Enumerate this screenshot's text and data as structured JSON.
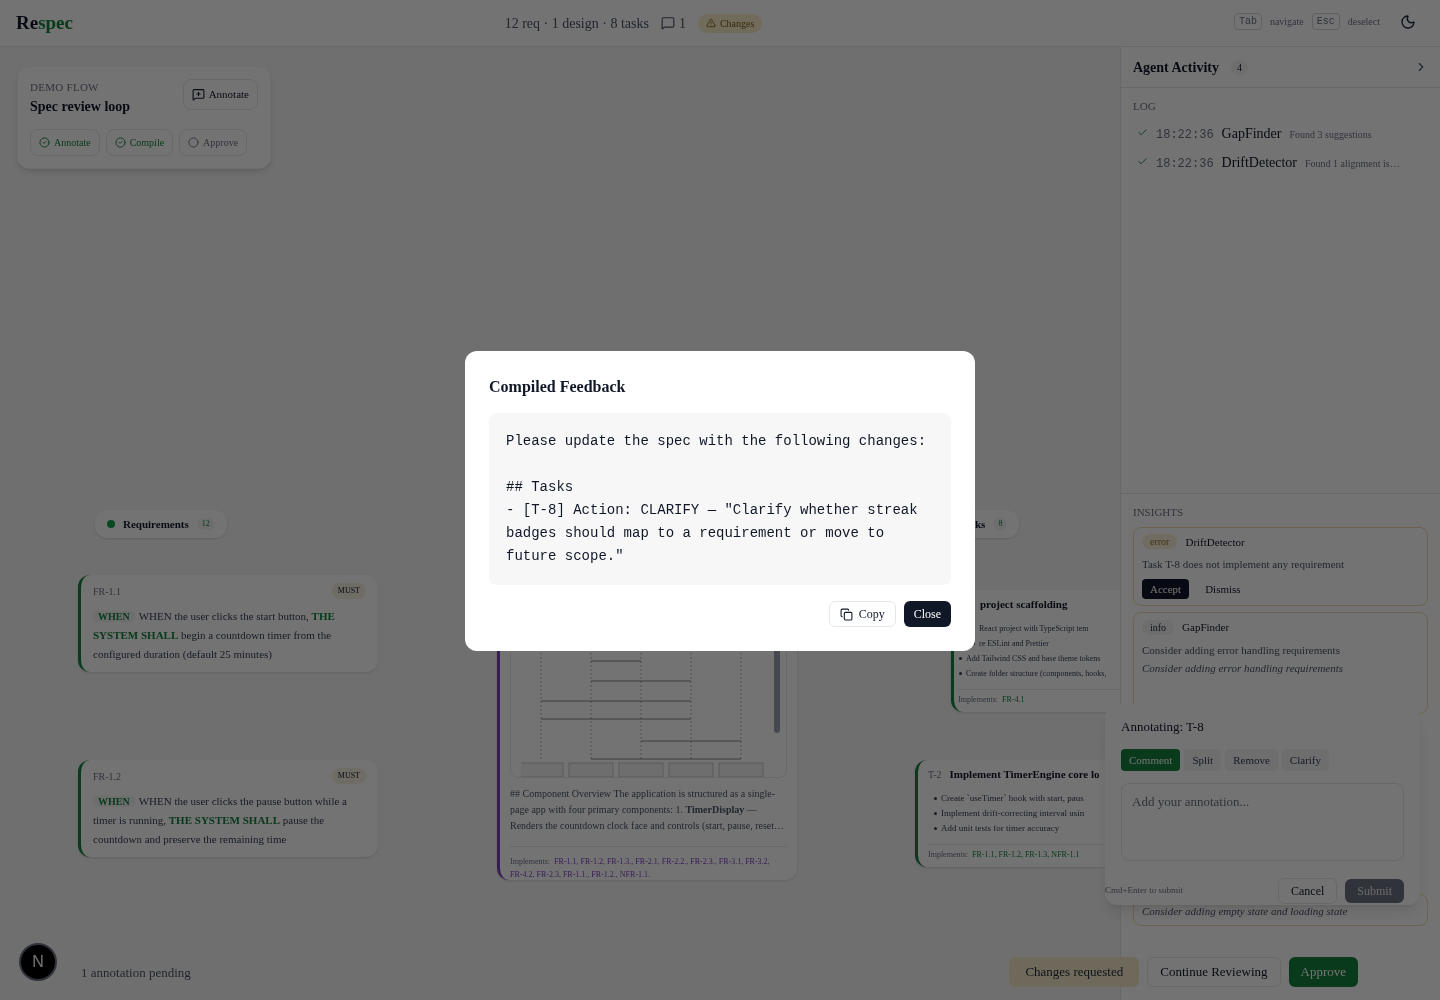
{
  "header": {
    "logo_dark": "Re",
    "logo_accent": "spec",
    "stats": "12 req · 1 design · 8 tasks",
    "comment_count": "1",
    "status_badge": "Changes",
    "shortcuts": [
      {
        "key": "Tab",
        "label": "navigate"
      },
      {
        "key": "Esc",
        "label": "deselect"
      }
    ]
  },
  "flow_card": {
    "eyebrow": "DEMO FLOW",
    "title": "Spec review loop",
    "action": "Annotate",
    "steps": [
      {
        "label": "Annotate",
        "done": true
      },
      {
        "label": "Compile",
        "done": true
      },
      {
        "label": "Approve",
        "done": false
      }
    ]
  },
  "canvas": {
    "requirements_pill": {
      "label": "Requirements",
      "count": "12"
    },
    "requirements": [
      {
        "id": "FR-1.1",
        "priority": "MUST",
        "keyword": "WHEN",
        "text": "WHEN the user clicks the start button, **THE SYSTEM SHALL** begin a countdown timer from the configured duration (default 25 minutes)"
      },
      {
        "id": "FR-1.2",
        "priority": "MUST",
        "keyword": "WHEN",
        "text": "WHEN the user clicks the pause button while a timer is running, **THE SYSTEM SHALL** pause the countdown and preserve the remaining time"
      }
    ],
    "design": {
      "text": "## Component Overview The application is structured as a single-page app with four primary components: 1. **TimerDisplay** — Renders the countdown clock face and controls (start, pause, reset…",
      "implements_label": "Implements:",
      "links": [
        "FR-1.1,",
        "FR-1.2,",
        "FR-1.3.,",
        "FR-2.1,",
        "FR-2.2.,",
        "FR-2.3.,",
        "FR-3.1,",
        "FR-3.2,",
        "FR-4.2,",
        "FR-2.3,",
        "FR-1.1.,",
        "FR-1.2.,",
        "NFR-1.1."
      ]
    },
    "tasks_pill": {
      "label": "ks",
      "count": "8"
    },
    "tasks": [
      {
        "title": "project scaffolding",
        "bullets": [
          "React project with TypeScript tem",
          "re ESLint and Prettier",
          "Add Tailwind CSS and base theme tokens",
          "Create folder structure (components, hooks,"
        ],
        "implements_label": "Implements:",
        "links": [
          "FR-4.1"
        ]
      },
      {
        "id": "T-2",
        "title": "Implement TimerEngine core lo",
        "bullets": [
          "Create `useTimer` hook with start, paus",
          "Implement drift-correcting interval usin",
          "Add unit tests for timer accuracy"
        ],
        "implements_label": "Implements:",
        "links": [
          "FR-1.1,",
          "FR-1.2,",
          "FR-1.3,",
          "NFR-1.1"
        ]
      }
    ]
  },
  "activity": {
    "title": "Agent Activity",
    "count": "4",
    "log_label": "LOG",
    "log": [
      {
        "time": "18:22:36",
        "agent": "GapFinder",
        "message": "Found 3 suggestions",
        "done": true
      },
      {
        "time": "18:22:36",
        "agent": "DriftDetector",
        "message": "Found 1 alignment is…",
        "done": true
      }
    ],
    "insights_label": "INSIGHTS",
    "insights": [
      {
        "severity": "error",
        "agent": "DriftDetector",
        "text": "Task T-8 does not implement any requirement",
        "actions": [
          "Accept",
          "Dismiss"
        ]
      },
      {
        "severity": "info",
        "agent": "GapFinder",
        "text": "Consider adding error handling requirements",
        "note": "Consider adding error handling requirements"
      },
      {
        "note": "Consider adding empty state and loading state"
      }
    ]
  },
  "annotation": {
    "title": "Annotating: T-8",
    "modes": [
      {
        "label": "Comment",
        "selected": true
      },
      {
        "label": "Split",
        "selected": false
      },
      {
        "label": "Remove",
        "selected": false
      },
      {
        "label": "Clarify",
        "selected": false
      }
    ],
    "placeholder": "Add your annotation...",
    "hint": "Cmd+Enter to submit",
    "cancel": "Cancel",
    "submit": "Submit",
    "submit_disabled": true
  },
  "footer": {
    "avatar": "N",
    "pending": "1 annotation pending",
    "status": "Changes requested",
    "continue": "Continue Reviewing",
    "approve": "Approve"
  },
  "dialog": {
    "title": "Compiled Feedback",
    "body": "Please update the spec with the following changes:\n\n## Tasks\n- [T-8] Action: CLARIFY — \"Clarify whether streak badges should map to a requirement or move to future scope.\"",
    "copy": "Copy",
    "close": "Close"
  }
}
